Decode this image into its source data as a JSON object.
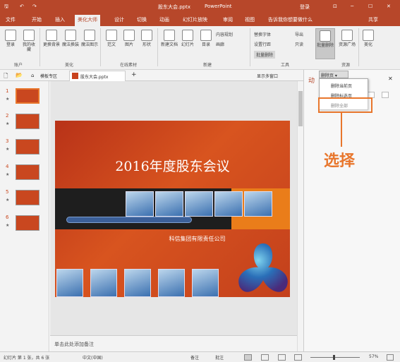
{
  "titlebar": {
    "doc_title": "股东大会.pptx",
    "app_name": "PowerPoint",
    "login": "登录",
    "qat_save": "🖫",
    "qat_undo": "↶",
    "qat_redo": "↷",
    "minimize": "─",
    "maximize": "☐",
    "close": "✕",
    "ribbon_toggle": "⊡"
  },
  "ribbon_tabs": [
    "文件",
    "开始",
    "插入",
    "美化大师",
    "设计",
    "切换",
    "动画",
    "幻灯片放映",
    "审阅",
    "视图"
  ],
  "active_tab": "美化大师",
  "search_placeholder": "告诉我你想要做什么",
  "share": "共享",
  "ribbon": {
    "groups": {
      "account": "账户",
      "beautify": "美化",
      "online": "在线素材",
      "new": "新建",
      "tools": "工具",
      "resources": "资源"
    },
    "buttons": {
      "login": "登录",
      "my_collection": "我的收藏",
      "change_bg": "更换背景",
      "magic_replace": "魔法换装",
      "magic_diagram": "魔法图示",
      "template": "范文",
      "picture": "图片",
      "shape": "形状",
      "new_doc": "新建文档",
      "slide": "幻灯片",
      "toc": "目录",
      "content_plan": "内容规划",
      "gallery": "画廊",
      "replace_font": "替换字体",
      "export": "导出",
      "line_spacing": "设置行距",
      "only_one": "只读",
      "batch_delete": "批量删除",
      "batch_delete_btn": "批量删除",
      "resource_square": "资源广场",
      "beautify_btn": "美化"
    }
  },
  "filetabs": {
    "template_zone": "模板专区",
    "current_file": "股东大会.pptx",
    "add": "+",
    "show_multi": "显示多窗口"
  },
  "thumbnails": [
    {
      "num": "1",
      "star": "★"
    },
    {
      "num": "2",
      "star": "★"
    },
    {
      "num": "3",
      "star": "★"
    },
    {
      "num": "4",
      "star": "★"
    },
    {
      "num": "5",
      "star": "★"
    },
    {
      "num": "6",
      "star": "★"
    }
  ],
  "slide": {
    "title": "2016年度股东会议",
    "company": "科信集团有限责任公司"
  },
  "notes_placeholder": "单击此处添加备注",
  "right_pane": {
    "header_char": "动",
    "close": "✕",
    "dropdown_button": "删除页 ▾"
  },
  "dropdown_menu": {
    "items": [
      "删除当前页",
      "删除标选页",
      "删除全部"
    ]
  },
  "callout": {
    "text": "选择"
  },
  "status": {
    "slide_info": "幻灯片 第 1 张，共 6 张",
    "language": "中文(中国)",
    "notes": "备注",
    "comments": "批注",
    "zoom": "57%"
  },
  "colors": {
    "accent": "#b7472a",
    "callout": "#e8762c"
  }
}
